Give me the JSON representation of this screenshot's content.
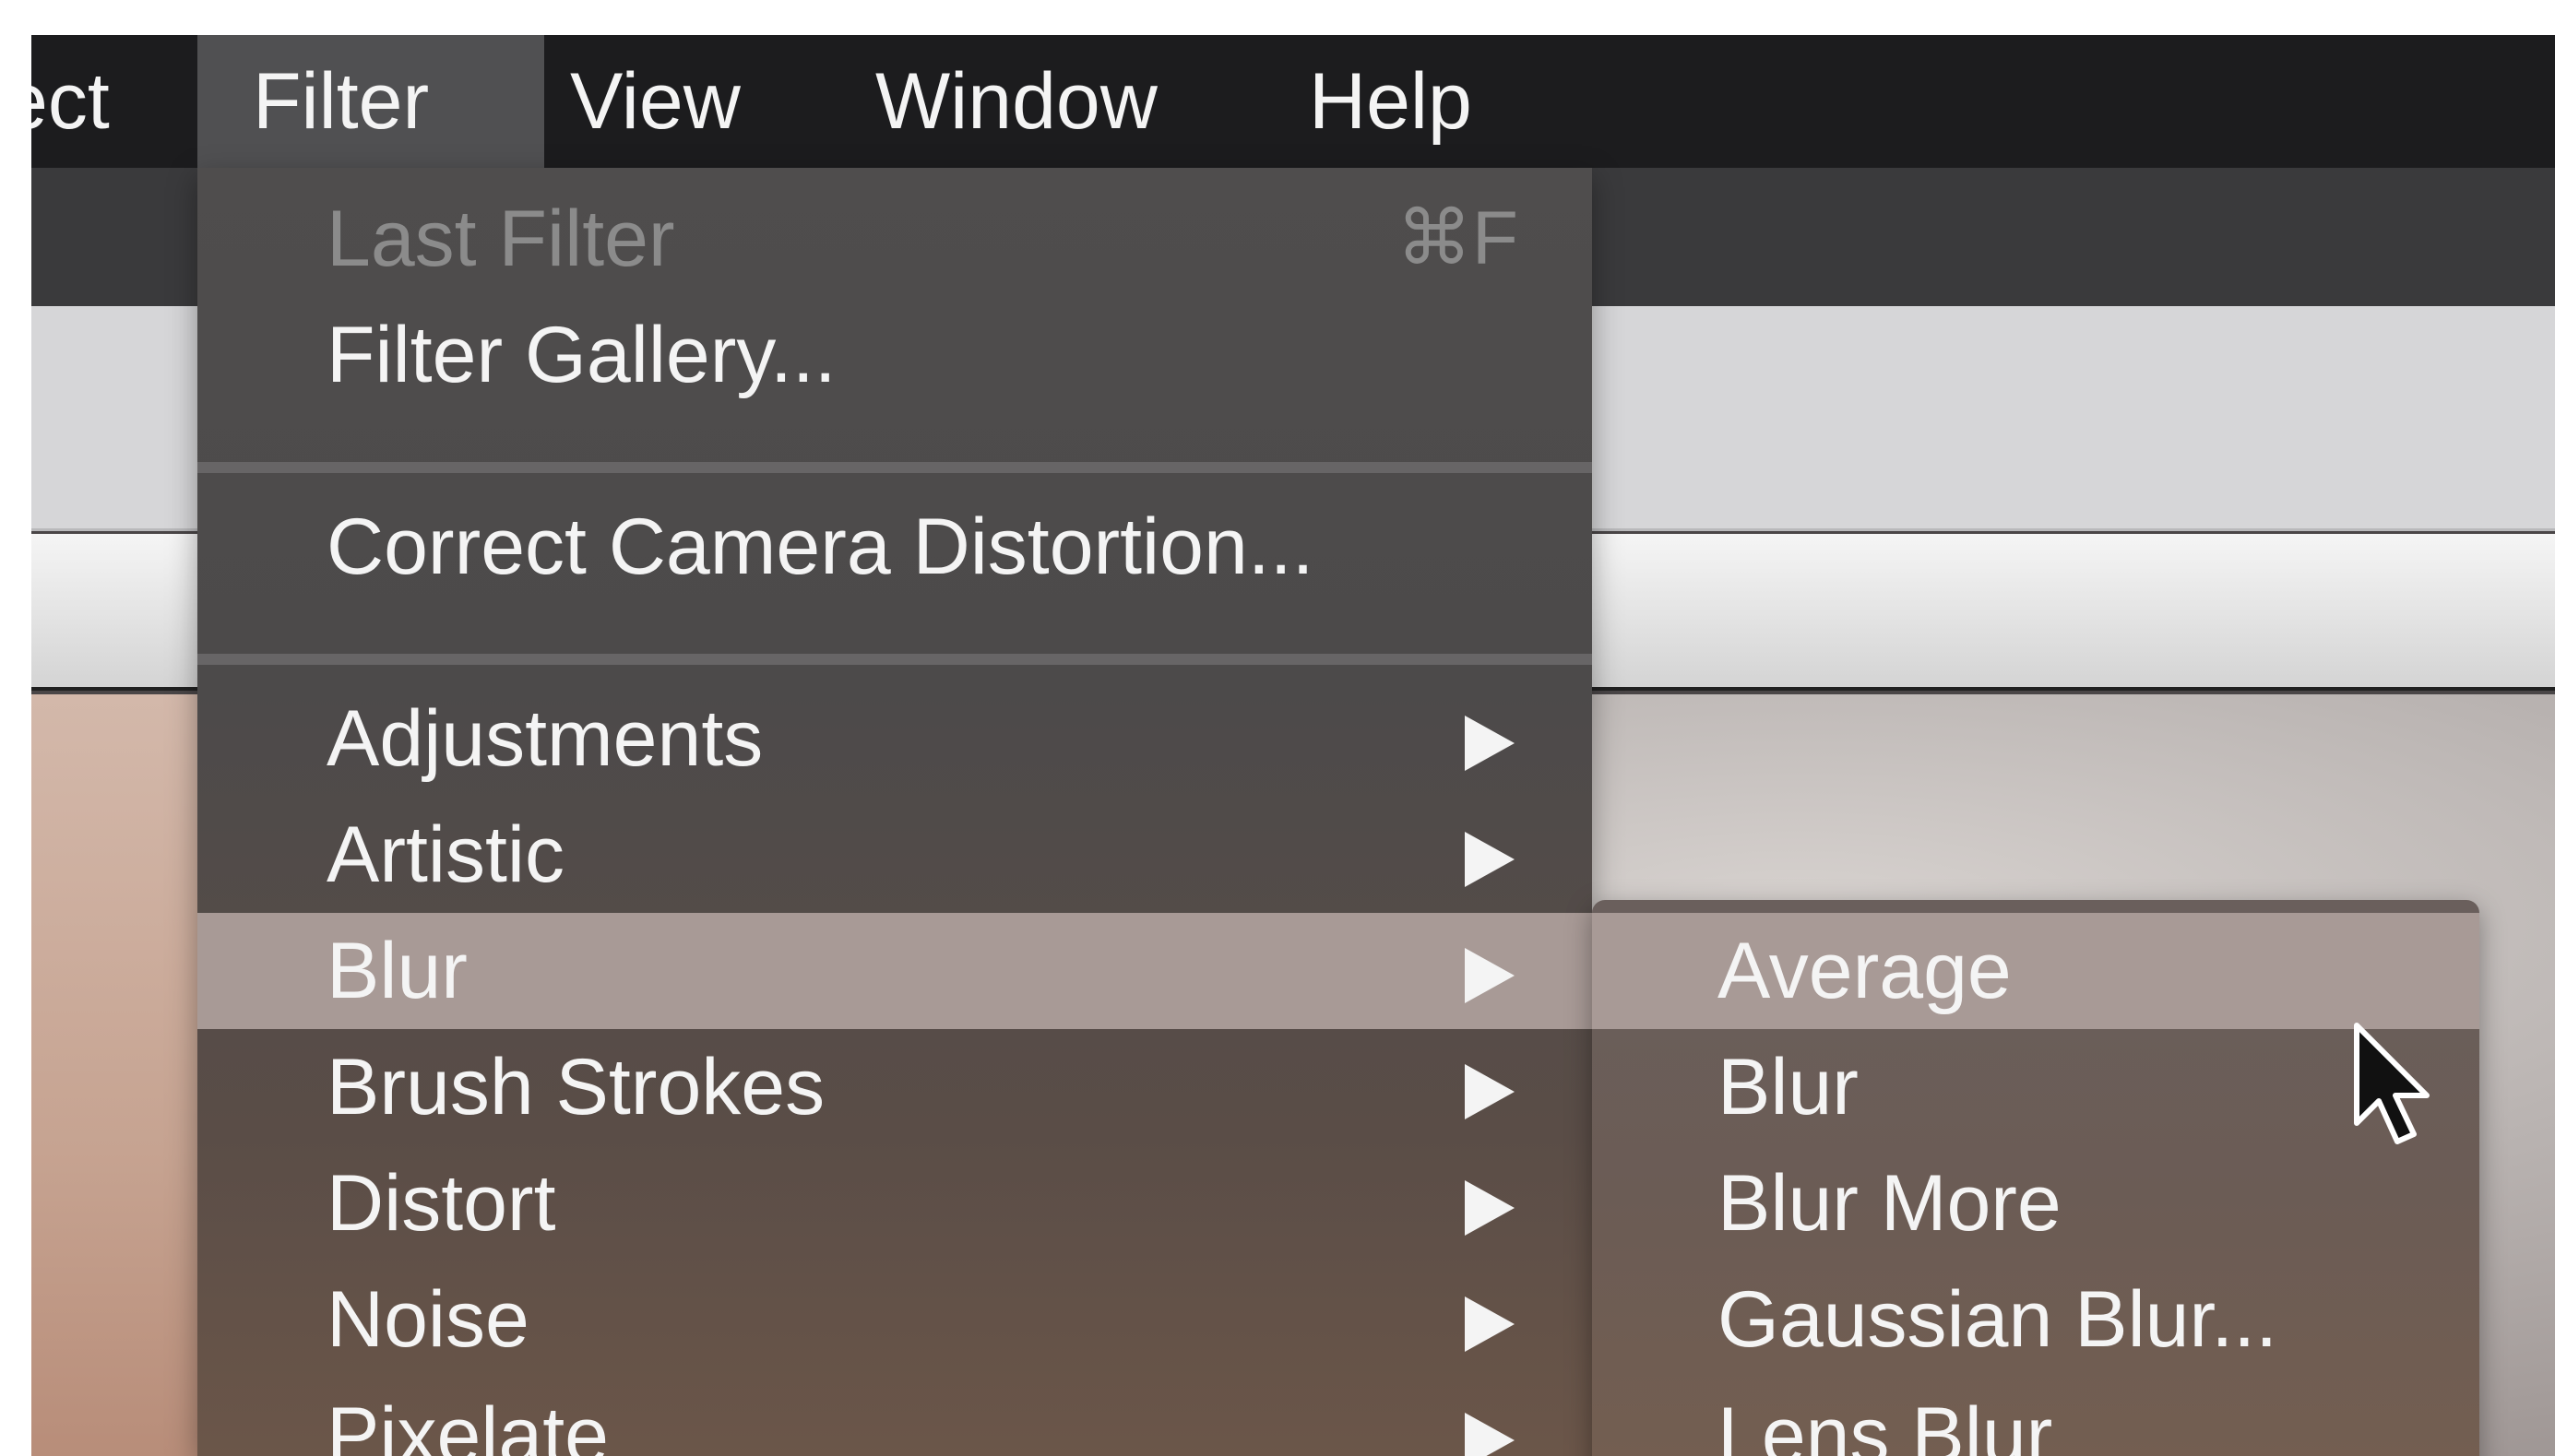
{
  "menubar": {
    "items": [
      {
        "label": "ect"
      },
      {
        "label": "Filter",
        "active": true
      },
      {
        "label": "View"
      },
      {
        "label": "Window"
      },
      {
        "label": "Help"
      }
    ]
  },
  "filter_menu": {
    "items": [
      {
        "label": "Last Filter",
        "shortcut": "⌘F",
        "disabled": true
      },
      {
        "label": "Filter Gallery..."
      },
      {
        "label": "Correct Camera Distortion..."
      },
      {
        "label": "Adjustments",
        "submenu": true
      },
      {
        "label": "Artistic",
        "submenu": true
      },
      {
        "label": "Blur",
        "submenu": true,
        "highlighted": true
      },
      {
        "label": "Brush Strokes",
        "submenu": true
      },
      {
        "label": "Distort",
        "submenu": true
      },
      {
        "label": "Noise",
        "submenu": true
      },
      {
        "label": "Pixelate",
        "submenu": true
      }
    ]
  },
  "blur_submenu": {
    "items": [
      {
        "label": "Average",
        "highlighted": true
      },
      {
        "label": "Blur"
      },
      {
        "label": "Blur More"
      },
      {
        "label": "Gaussian Blur..."
      },
      {
        "label": "Lens Blur"
      }
    ]
  },
  "cursor": {
    "icon": "arrow-pointer-icon"
  },
  "colors": {
    "menubar_bg": "#1c1c1e",
    "menu_bg": "#4c4a4a",
    "highlight": "#a89a96",
    "text": "#f4f4f4",
    "disabled_text": "#8b8b8b"
  }
}
